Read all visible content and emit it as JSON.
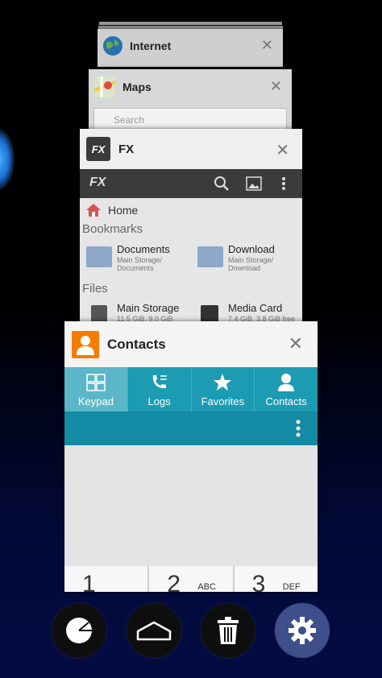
{
  "apps": {
    "internet": {
      "title": "Internet"
    },
    "maps": {
      "title": "Maps",
      "search_placeholder": "Search"
    },
    "fx": {
      "title": "FX",
      "home_label": "Home",
      "bookmarks_label": "Bookmarks",
      "files_label": "Files",
      "bookmarks": [
        {
          "name": "Documents",
          "sub": "Main Storage/\nDocuments"
        },
        {
          "name": "Download",
          "sub": "Main Storage/\nDownload"
        }
      ],
      "files": [
        {
          "name": "Main Storage",
          "sub": "11.5 GiB, 9.0 GiB free"
        },
        {
          "name": "Media Card",
          "sub": "7.4 GiB, 3.8 GiB free"
        }
      ]
    },
    "contacts": {
      "title": "Contacts",
      "tabs": [
        {
          "label": "Keypad",
          "active": true
        },
        {
          "label": "Logs",
          "active": false
        },
        {
          "label": "Favorites",
          "active": false
        },
        {
          "label": "Contacts",
          "active": false
        }
      ],
      "keys": [
        {
          "num": "1",
          "letters": ""
        },
        {
          "num": "2",
          "letters": "ABC"
        },
        {
          "num": "3",
          "letters": "DEF"
        }
      ]
    }
  },
  "bottom_buttons": [
    {
      "icon": "pie-chart-icon"
    },
    {
      "icon": "home-icon"
    },
    {
      "icon": "trash-icon"
    },
    {
      "icon": "gear-icon"
    }
  ],
  "colors": {
    "contacts_tab_bar": "#1c9bb3",
    "contacts_action_bar": "#138ba4",
    "contacts_icon": "#f57c00",
    "settings_button": "#3e4f8c",
    "fx_toolbar": "#3b3b3b"
  }
}
